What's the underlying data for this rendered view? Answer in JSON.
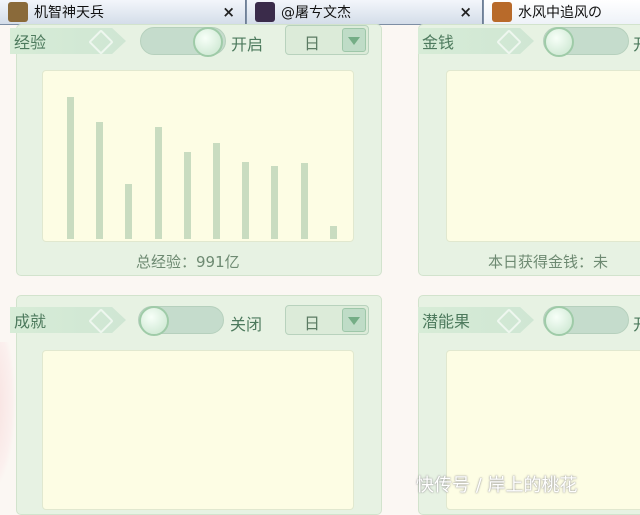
{
  "tabs": [
    {
      "label": "机智神天兵",
      "close": "×",
      "avatar_color": "#8a6a3a"
    },
    {
      "label": "@屠ㄘ文杰",
      "close": "×",
      "avatar_color": "#3a2b4a"
    },
    {
      "label": "水风中追风の",
      "avatar_color": "#b86a2a"
    }
  ],
  "panels": {
    "experience": {
      "label": "经验",
      "toggle_text": "开启",
      "select_value": "日",
      "bars": [
        90,
        74,
        35,
        71,
        55,
        61,
        49,
        46,
        48,
        8
      ],
      "bar_max": 100,
      "summary": "总经验：991亿"
    },
    "money": {
      "label": "金钱",
      "toggle_text": "开",
      "summary": "本日获得金钱：未"
    },
    "achievement": {
      "label": "成就",
      "toggle_text": "关闭",
      "select_value": "日"
    },
    "potential": {
      "label": "潜能果",
      "toggle_text": "开"
    }
  },
  "watermark": "快传号 / 岸上的桃花"
}
